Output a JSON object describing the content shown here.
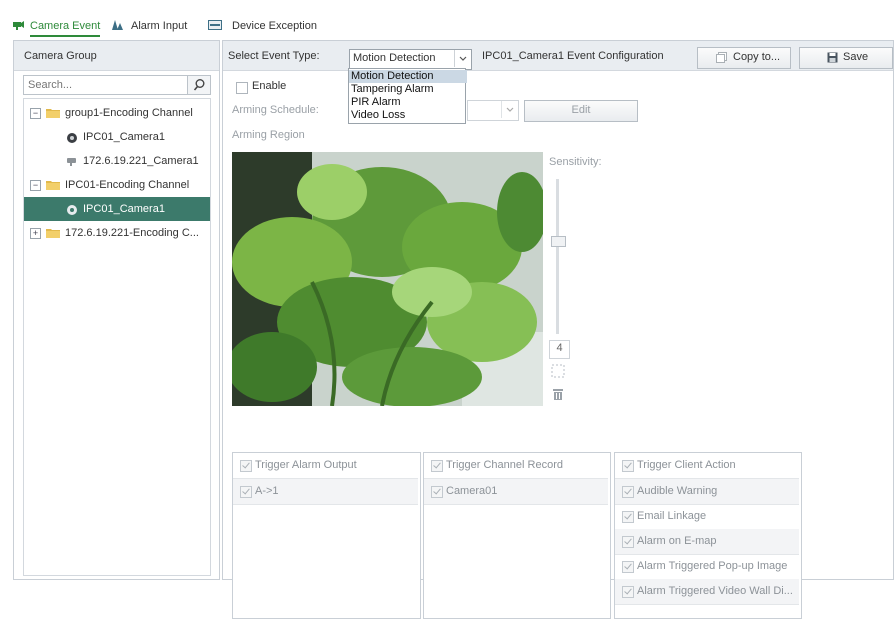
{
  "tabs": [
    {
      "label": "Camera Event",
      "icon": "camera-event-icon",
      "active": true
    },
    {
      "label": "Alarm Input",
      "icon": "alarm-input-icon",
      "active": false
    },
    {
      "label": "Device Exception",
      "icon": "device-exception-icon",
      "active": false
    }
  ],
  "left_panel": {
    "title": "Camera Group",
    "search_placeholder": "Search...",
    "tree": [
      {
        "label": "group1-Encoding Channel",
        "type": "group",
        "toggle": "−"
      },
      {
        "label": "IPC01_Camera1",
        "type": "camera"
      },
      {
        "label": "172.6.19.221_Camera1",
        "type": "camera"
      },
      {
        "label": "IPC01-Encoding Channel",
        "type": "group",
        "toggle": "−"
      },
      {
        "label": "IPC01_Camera1",
        "type": "camera",
        "selected": true
      },
      {
        "label": "172.6.19.221-Encoding C...",
        "type": "group",
        "toggle": "+"
      }
    ]
  },
  "event_config": {
    "select_label": "Select Event Type:",
    "selected_event": "Motion Detection",
    "config_title": "IPC01_Camera1 Event Configuration",
    "copy_label": "Copy to...",
    "save_label": "Save",
    "dropdown_options": [
      "Motion Detection",
      "Tampering Alarm",
      "PIR Alarm",
      "Video Loss"
    ],
    "enable_label": "Enable",
    "arming_schedule_label": "Arming Schedule:",
    "edit_label": "Edit",
    "arming_region_label": "Arming Region",
    "sensitivity_label": "Sensitivity:",
    "sensitivity_value": "4"
  },
  "triggers": {
    "alarm_output": {
      "header": "Trigger Alarm Output",
      "items": [
        "A->1"
      ]
    },
    "channel_record": {
      "header": "Trigger Channel Record",
      "items": [
        "Camera01"
      ]
    },
    "client_action": {
      "header": "Trigger Client Action",
      "items": [
        "Audible Warning",
        "Email Linkage",
        "Alarm on E-map",
        "Alarm Triggered Pop-up Image",
        "Alarm Triggered Video Wall Di..."
      ]
    }
  },
  "colors": {
    "accent_green": "#2e8a3a",
    "selected_row": "#3c7a6b",
    "header_bg": "#e9edf1"
  }
}
